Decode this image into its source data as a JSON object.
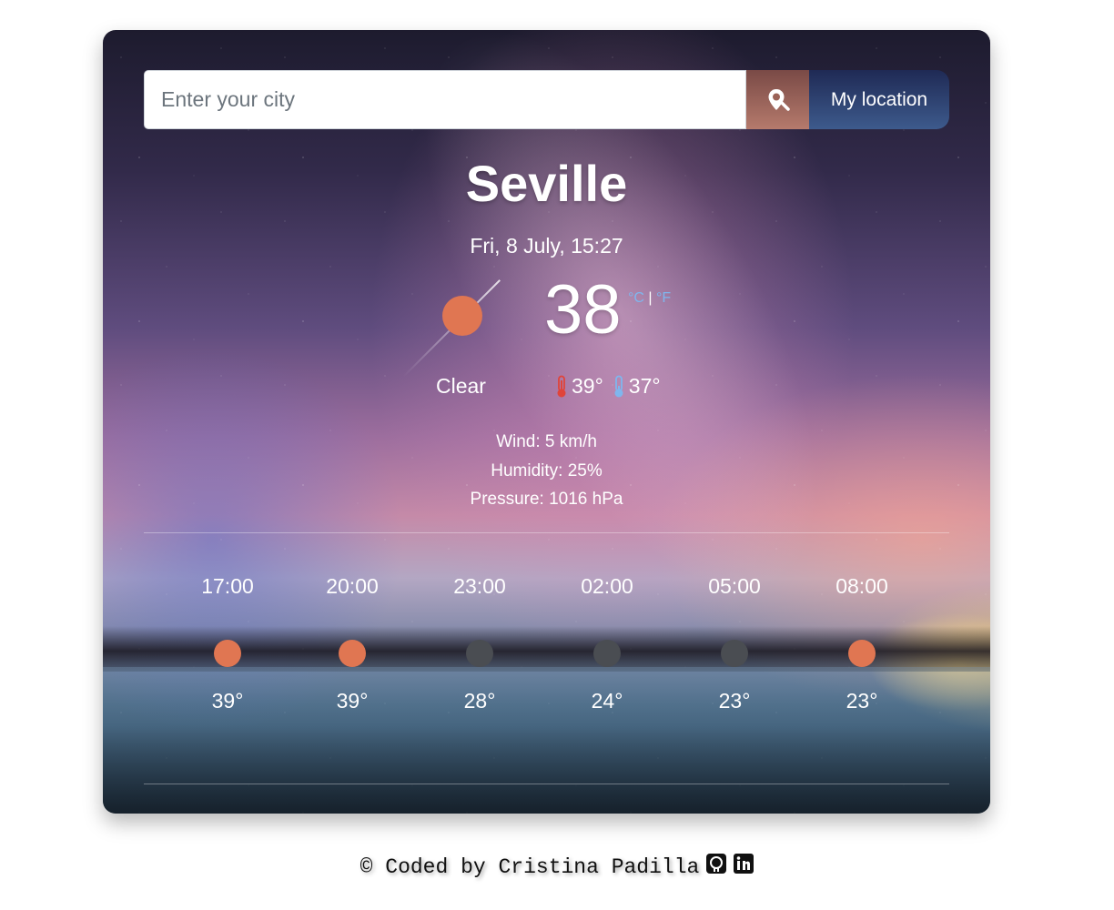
{
  "search": {
    "placeholder": "Enter your city",
    "value": "",
    "location_button_label": "My location",
    "pin_icon": "map-pin-search-icon"
  },
  "current": {
    "city": "Seville",
    "datetime": "Fri, 8 July, 15:27",
    "temperature": "38",
    "unit_celsius": "°C",
    "unit_separator": "|",
    "unit_fahrenheit": "°F",
    "condition_icon": "sun-icon",
    "description": "Clear",
    "temp_max": "39°",
    "temp_min": "37°"
  },
  "details": {
    "wind": "Wind: 5 km/h",
    "humidity": "Humidity: 25%",
    "pressure": "Pressure: 1016 hPa"
  },
  "forecast": [
    {
      "time": "17:00",
      "temp": "39°",
      "icon": "sun-icon",
      "color": "#e07652"
    },
    {
      "time": "20:00",
      "temp": "39°",
      "icon": "sun-icon",
      "color": "#e07652"
    },
    {
      "time": "23:00",
      "temp": "28°",
      "icon": "moon-icon",
      "color": "#4a4d52"
    },
    {
      "time": "02:00",
      "temp": "24°",
      "icon": "moon-icon",
      "color": "#4a4d52"
    },
    {
      "time": "05:00",
      "temp": "23°",
      "icon": "moon-icon",
      "color": "#4a4d52"
    },
    {
      "time": "08:00",
      "temp": "23°",
      "icon": "sun-icon",
      "color": "#e07652"
    }
  ],
  "footer": {
    "text": "© Coded by Cristina Padilla",
    "github_icon": "github-icon",
    "linkedin_icon": "linkedin-icon"
  },
  "colors": {
    "sun": "#e07652",
    "night": "#4a4d52",
    "unit_link": "#7fb6ee",
    "thermo_hot": "#e0443a",
    "thermo_cold": "#7fb6ee"
  }
}
